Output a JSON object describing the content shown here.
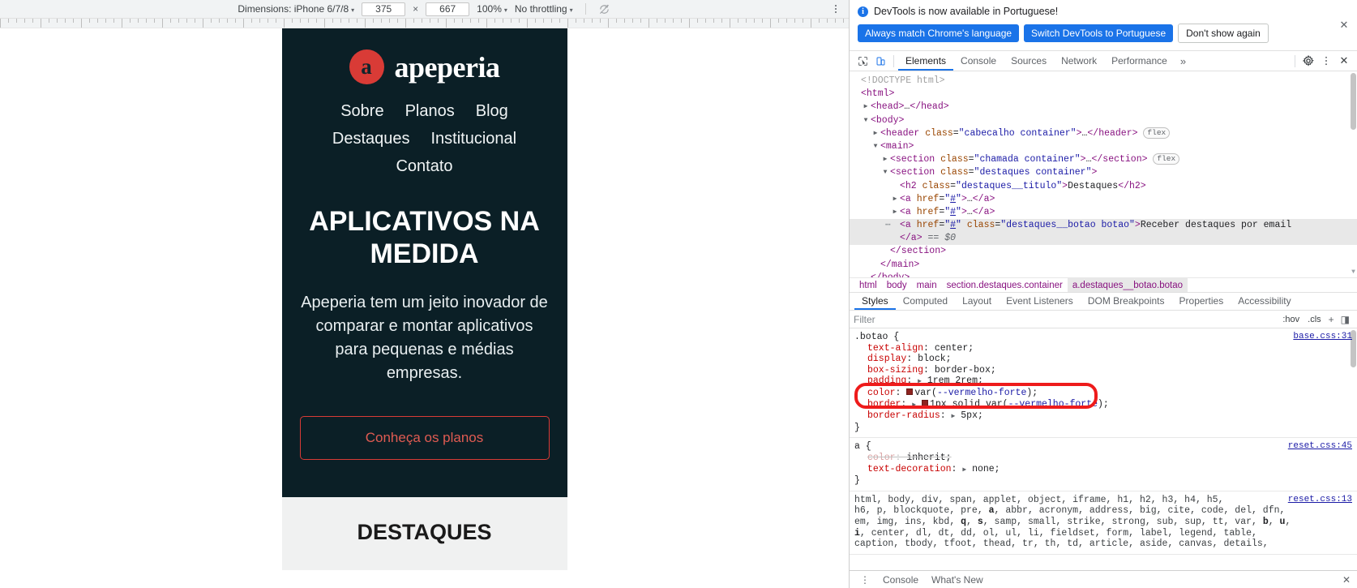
{
  "device_toolbar": {
    "dimensions_label": "Dimensions: iPhone 6/7/8",
    "width_value": "375",
    "height_value": "667",
    "times_symbol": "×",
    "zoom_label": "100%",
    "throttling_label": "No throttling",
    "caret": "▾"
  },
  "site": {
    "brand_initial": "a",
    "brand_name": "apeperia",
    "nav": [
      "Sobre",
      "Planos",
      "Blog",
      "Destaques",
      "Institucional",
      "Contato"
    ],
    "hero_title": "APLICATIVOS NA MEDIDA",
    "hero_text": "Apeperia tem um jeito inovador de comparar e montar aplicativos para pequenas e médias empresas.",
    "hero_button": "Conheça os planos",
    "below_title": "DESTAQUES"
  },
  "notification": {
    "message": "DevTools is now available in Portuguese!",
    "info_glyph": "i",
    "btn_always": "Always match Chrome's language",
    "btn_switch": "Switch DevTools to Portuguese",
    "btn_dismiss": "Don't show again",
    "close_glyph": "✕"
  },
  "devtools_tabs": {
    "items": [
      "Elements",
      "Console",
      "Sources",
      "Network",
      "Performance"
    ],
    "selected": "Elements",
    "more_glyph": "»",
    "close_glyph": "✕"
  },
  "dom": {
    "lines": [
      {
        "indent": 0,
        "arrow": "",
        "html": "<span class=\"cm\">&lt;!DOCTYPE html&gt;</span>"
      },
      {
        "indent": 0,
        "arrow": "",
        "html": "<span class=\"tg\">&lt;html&gt;</span>"
      },
      {
        "indent": 1,
        "arrow": "▶",
        "html": "<span class=\"tg\">&lt;head&gt;</span><span class=\"pn\">…</span><span class=\"tg\">&lt;/head&gt;</span>"
      },
      {
        "indent": 1,
        "arrow": "▼",
        "html": "<span class=\"tg\">&lt;body&gt;</span>"
      },
      {
        "indent": 2,
        "arrow": "▶",
        "html": "<span class=\"tg\">&lt;header</span> <span class=\"at\">class</span>=<span class=\"av\">\"cabecalho container\"</span><span class=\"tg\">&gt;</span><span class=\"pn\">…</span><span class=\"tg\">&lt;/header&gt;</span> <span class=\"badge-flex\">flex</span>"
      },
      {
        "indent": 2,
        "arrow": "▼",
        "html": "<span class=\"tg\">&lt;main&gt;</span>"
      },
      {
        "indent": 3,
        "arrow": "▶",
        "html": "<span class=\"tg\">&lt;section</span> <span class=\"at\">class</span>=<span class=\"av\">\"chamada container\"</span><span class=\"tg\">&gt;</span><span class=\"pn\">…</span><span class=\"tg\">&lt;/section&gt;</span> <span class=\"badge-flex\">flex</span>"
      },
      {
        "indent": 3,
        "arrow": "▼",
        "html": "<span class=\"tg\">&lt;section</span> <span class=\"at\">class</span>=<span class=\"av\">\"destaques container\"</span><span class=\"tg\">&gt;</span>"
      },
      {
        "indent": 4,
        "arrow": "",
        "html": "<span class=\"tg\">&lt;h2</span> <span class=\"at\">class</span>=<span class=\"av\">\"destaques__titulo\"</span><span class=\"tg\">&gt;</span><span class=\"pn\">Destaques</span><span class=\"tg\">&lt;/h2&gt;</span>"
      },
      {
        "indent": 4,
        "arrow": "▶",
        "html": "<span class=\"tg\">&lt;a</span> <span class=\"at\">href</span>=<span class=\"av\">\"</span><span class=\"lnk\">#</span><span class=\"av\">\"</span><span class=\"tg\">&gt;</span><span class=\"pn\">…</span><span class=\"tg\">&lt;/a&gt;</span>"
      },
      {
        "indent": 4,
        "arrow": "▶",
        "html": "<span class=\"tg\">&lt;a</span> <span class=\"at\">href</span>=<span class=\"av\">\"</span><span class=\"lnk\">#</span><span class=\"av\">\"</span><span class=\"tg\">&gt;</span><span class=\"pn\">…</span><span class=\"tg\">&lt;/a&gt;</span>"
      },
      {
        "indent": 4,
        "arrow": "",
        "selected": true,
        "dots": true,
        "html": "<span class=\"tg\">&lt;a</span> <span class=\"at\">href</span>=<span class=\"av\">\"</span><span class=\"lnk\">#</span><span class=\"av\">\"</span> <span class=\"at\">class</span>=<span class=\"av\">\"destaques__botao botao\"</span><span class=\"tg\">&gt;</span><span class=\"pn\">Receber destaques por email</span>"
      },
      {
        "indent": 4,
        "arrow": "",
        "selected": true,
        "html": "<span class=\"tg\">&lt;/a&gt;</span> <span class=\"dollar\">== $0</span>"
      },
      {
        "indent": 3,
        "arrow": "",
        "html": "<span class=\"tg\">&lt;/section&gt;</span>"
      },
      {
        "indent": 2,
        "arrow": "",
        "html": "<span class=\"tg\">&lt;/main&gt;</span>"
      },
      {
        "indent": 1,
        "arrow": "",
        "html": "<span class=\"tg\">&lt;/body&gt;</span>"
      }
    ]
  },
  "breadcrumb": {
    "items": [
      "html",
      "body",
      "main",
      "section.destaques.container",
      "a.destaques__botao.botao"
    ],
    "selected_index": 4
  },
  "styles_tabs": {
    "items": [
      "Styles",
      "Computed",
      "Layout",
      "Event Listeners",
      "DOM Breakpoints",
      "Properties",
      "Accessibility"
    ],
    "selected": "Styles"
  },
  "filter": {
    "placeholder": "Filter",
    "value": "",
    "hov_label": ":hov",
    "cls_label": ".cls",
    "plus_glyph": "+",
    "panel_glyph": "◨"
  },
  "css_rules": [
    {
      "selector": ".botao {",
      "origin": "base.css:31",
      "close": "}",
      "declarations": [
        {
          "prop": "text-align",
          "value": "center;"
        },
        {
          "prop": "display",
          "value": "block;"
        },
        {
          "prop": "box-sizing",
          "value": "border-box;"
        },
        {
          "prop": "padding",
          "value": "1rem 2rem;",
          "triangle": true
        },
        {
          "prop": "color",
          "value": "var(--vermelho-forte);",
          "swatch": "#8e2420",
          "var": true
        },
        {
          "prop": "border",
          "value": "1px solid var(--vermelho-forte);",
          "triangle": true,
          "swatch": "#8e2420",
          "var": true
        },
        {
          "prop": "border-radius",
          "value": "5px;",
          "triangle": true
        }
      ]
    },
    {
      "selector": "a {",
      "origin": "reset.css:45",
      "close": "}",
      "declarations": [
        {
          "prop": "color",
          "value": "inherit;",
          "strike": true
        },
        {
          "prop": "text-decoration",
          "value": "none;",
          "triangle": true
        }
      ]
    }
  ],
  "reset_rule": {
    "origin": "reset.css:13",
    "selector_lines": [
      "html, body, div, span, applet, object, iframe, h1, h2, h3, h4, h5,",
      "h6, p, blockquote, pre, a, abbr, acronym, address, big, cite, code, del, dfn,",
      "em, img, ins, kbd, q, s, samp, small, strike, strong, sub, sup, tt, var, b, u,",
      "i, center, dl, dt, dd, ol, ul, li, fieldset, form, label, legend, table,",
      "caption, tbody, tfoot, thead, tr, th, td, article, aside, canvas, details,"
    ]
  },
  "drawer": {
    "tabs": [
      "Console",
      "What's New"
    ],
    "close_glyph": "✕",
    "kebab_glyph": "⋮"
  },
  "colors": {
    "accent_blue": "#1a73e8",
    "annotation_red": "#ee1b1b",
    "brand_red": "#d93b36",
    "site_dark": "#0b1f26",
    "vermelho_forte": "#8e2420"
  }
}
